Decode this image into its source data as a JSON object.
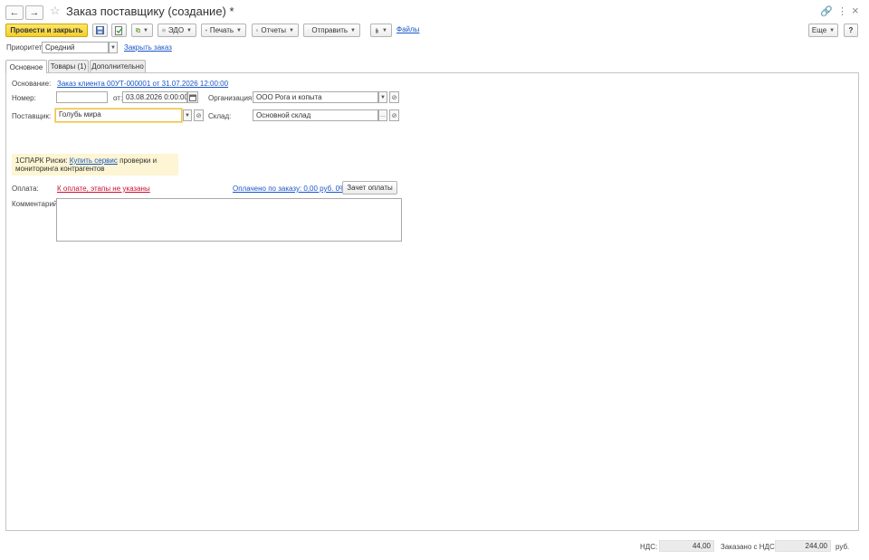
{
  "window": {
    "title": "Заказ поставщику (создание) *"
  },
  "icons": {
    "back": "←",
    "forward": "→",
    "star": "☆",
    "link": "🔗",
    "more": "⋮",
    "close": "×",
    "save": "💾",
    "doc": "📄",
    "attach": "📎"
  },
  "toolbar": {
    "post_close": "Провести и закрыть",
    "edo": "ЭДО",
    "print": "Печать",
    "reports": "Отчеты",
    "send": "Отправить",
    "files": "Файлы",
    "more": "Еще",
    "help": "?"
  },
  "header": {
    "priority_label": "Приоритет:",
    "priority_value": "Средний",
    "close_order_link": "Закрыть заказ"
  },
  "tabs": [
    {
      "label": "Основное"
    },
    {
      "label": "Товары (1)"
    },
    {
      "label": "Дополнительно"
    }
  ],
  "form": {
    "basis_label": "Основание:",
    "basis_link": "Заказ клиента 00УТ-000001 от 31.07.2026 12:00:00",
    "number_label": "Номер:",
    "number_value": "",
    "from_label": "от:",
    "date_value": "03.08.2026  0:00:00",
    "org_label": "Организация:",
    "org_value": "ООО Рога и копыта",
    "supplier_label": "Поставщик:",
    "supplier_value": "Голубь мира",
    "warehouse_label": "Склад:",
    "warehouse_value": "Основной склад",
    "spark_prefix": "1СПАРК Риски: ",
    "spark_link": "Купить сервис",
    "spark_suffix": " проверки и мониторинга контрагентов",
    "payment_label": "Оплата:",
    "payment_link": "К оплате, этапы не указаны",
    "paid_link": "Оплачено по заказу: 0,00 руб. 0%",
    "offset_button": "Зачет оплаты",
    "comment_label": "Комментарий:",
    "comment_value": ""
  },
  "footer": {
    "vat_label": "НДС:",
    "vat_value": "44,00",
    "total_label": "Заказано с НДС:",
    "total_value": "244,00",
    "currency": "руб."
  }
}
